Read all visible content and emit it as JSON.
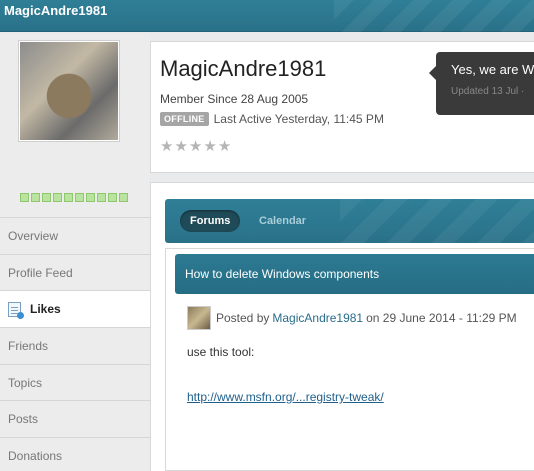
{
  "header": {
    "title": "MagicAndre1981"
  },
  "sidebar": {
    "rep_pips": 10,
    "items": [
      {
        "label": "Overview",
        "active": false
      },
      {
        "label": "Profile Feed",
        "active": false
      },
      {
        "label": "Likes",
        "active": true,
        "icon": "likes-icon"
      },
      {
        "label": "Friends",
        "active": false
      },
      {
        "label": "Topics",
        "active": false
      },
      {
        "label": "Posts",
        "active": false
      },
      {
        "label": "Donations",
        "active": false
      }
    ]
  },
  "profile": {
    "name": "MagicAndre1981",
    "member_since": "Member Since 28 Aug 2005",
    "status_badge": "OFFLINE",
    "last_active": "Last Active Yesterday, 11:45 PM",
    "rating_stars": 5,
    "rating_filled": 0
  },
  "tooltip": {
    "text": "Yes, we are W",
    "sub": "Updated 13 Jul ·"
  },
  "tabs": [
    {
      "label": "Forums",
      "active": true
    },
    {
      "label": "Calendar",
      "active": false
    }
  ],
  "post": {
    "topic_title": "How to delete Windows components",
    "posted_by_prefix": "Posted by",
    "author": "MagicAndre1981",
    "date": "on 29 June 2014 - 11:29 PM",
    "body": "use this tool:",
    "link": "http://www.msfn.org/...registry-tweak/"
  },
  "colors": {
    "header_bg": "#2a7189",
    "badge_gray": "#a5a5a5",
    "rep_green": "#b9e39f",
    "link": "#1f5f8c"
  }
}
